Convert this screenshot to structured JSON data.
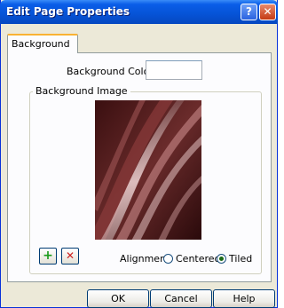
{
  "window": {
    "title": "Edit Page Properties",
    "help_glyph": "?",
    "close_glyph": "✕"
  },
  "tabs": [
    {
      "label": "Background",
      "active": true
    }
  ],
  "background": {
    "color_label": "Background Color:",
    "color_value": "#ffffff",
    "image_group_label": "Background Image",
    "add_glyph": "+",
    "remove_glyph": "✕",
    "alignment_label": "Alignment:",
    "alignment_options": [
      {
        "label": "Centered",
        "selected": false
      },
      {
        "label": "Tiled",
        "selected": true
      }
    ]
  },
  "buttons": {
    "ok": "OK",
    "cancel": "Cancel",
    "help": "Help"
  },
  "colors": {
    "titlebar": "#0653d6",
    "panel": "#fcfcfe",
    "dialog": "#ece9d8",
    "add_icon": "#1a9b1a",
    "remove_icon": "#cc1f1f"
  }
}
